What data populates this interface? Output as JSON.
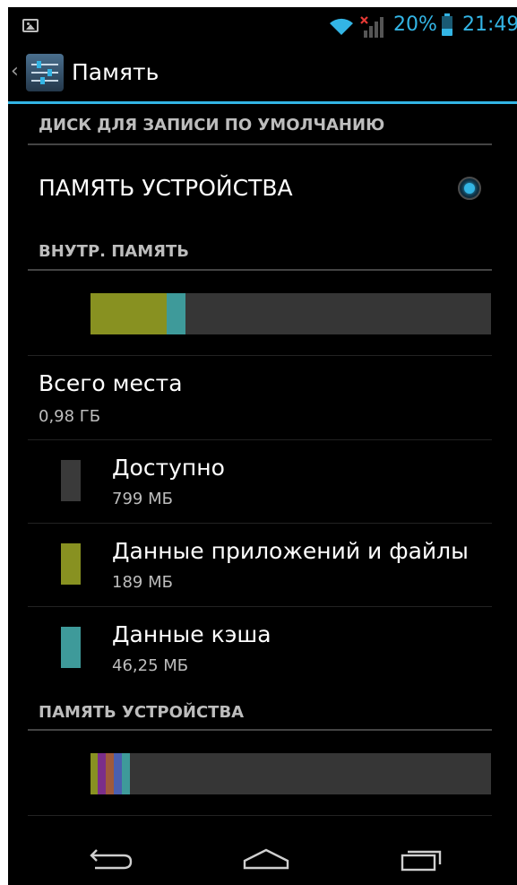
{
  "status_bar": {
    "battery_percent": "20%",
    "time": "21:49",
    "accent_color": "#33b5e5",
    "icons": [
      "picture-notification-icon",
      "wifi-icon",
      "no-signal-icon",
      "battery-icon"
    ]
  },
  "action_bar": {
    "back_chevron": "‹",
    "title": "Память",
    "app_icon": "settings-sliders-icon"
  },
  "default_disk": {
    "header": "ДИСК ДЛЯ ЗАПИСИ ПО УМОЛЧАНИЮ",
    "option_label": "ПАМЯТЬ УСТРОЙСТВА",
    "option_selected": true
  },
  "internal_storage": {
    "header": "ВНУТР. ПАМЯТЬ",
    "usage_bar": [
      {
        "name": "apps",
        "fraction": 0.19,
        "color": "#889121"
      },
      {
        "name": "cache",
        "fraction": 0.047,
        "color": "#3e9a9a"
      }
    ],
    "total": {
      "label": "Всего места",
      "value": "0,98 ГБ"
    },
    "items": [
      {
        "label": "Доступно",
        "value": "799 МБ",
        "color": "#3a3a3a"
      },
      {
        "label": "Данные приложений и файлы",
        "value": "189 МБ",
        "color": "#889121"
      },
      {
        "label": "Данные кэша",
        "value": "46,25 МБ",
        "color": "#3e9a9a"
      }
    ]
  },
  "device_storage": {
    "header": "ПАМЯТЬ УСТРОЙСТВА",
    "usage_bar": [
      {
        "name": "segment-1",
        "fraction": 0.018,
        "color": "#889121"
      },
      {
        "name": "segment-2",
        "fraction": 0.02,
        "color": "#7b2e8a"
      },
      {
        "name": "segment-3",
        "fraction": 0.02,
        "color": "#a05a3c"
      },
      {
        "name": "segment-4",
        "fraction": 0.02,
        "color": "#4b5fb0"
      },
      {
        "name": "segment-5",
        "fraction": 0.02,
        "color": "#3e9a9a"
      }
    ]
  },
  "nav_bar": {
    "buttons": [
      "back-icon",
      "home-icon",
      "recent-apps-icon"
    ]
  }
}
